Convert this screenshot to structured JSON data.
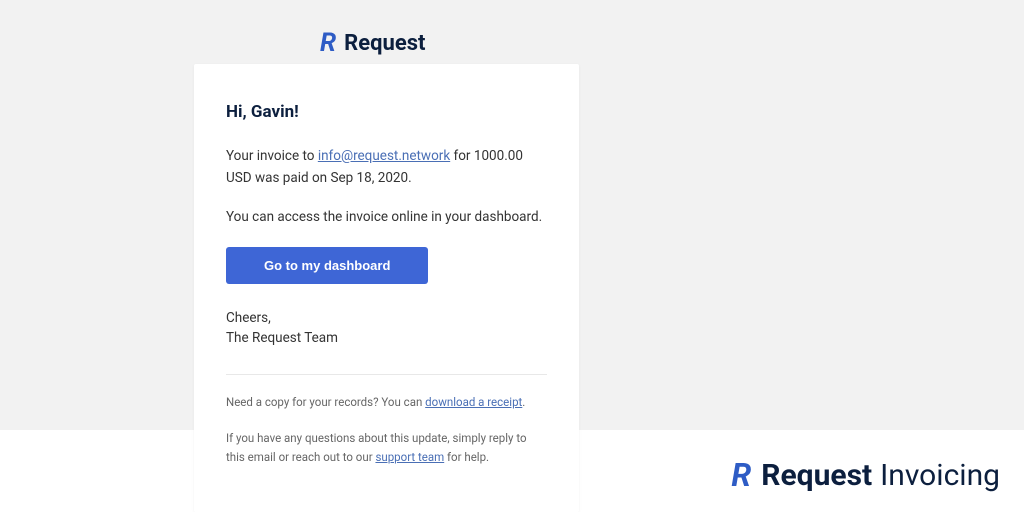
{
  "logo": {
    "brand": "Request"
  },
  "email": {
    "greeting": "Hi, Gavin!",
    "line1_pre": "Your invoice to ",
    "line1_email": "info@request.network",
    "line1_post": " for 1000.00 USD was paid on Sep 18, 2020.",
    "line2": "You can access the invoice online in your dashboard.",
    "cta": "Go to my dashboard",
    "signoff_line1": "Cheers,",
    "signoff_line2": "The Request Team",
    "footer1_pre": "Need a copy for your records? You can ",
    "footer1_link": "download a receipt",
    "footer1_post": ".",
    "footer2_pre": "If you have any questions about this update, simply reply to this email or reach out to our ",
    "footer2_link": "support team",
    "footer2_post": " for help."
  },
  "watermark": {
    "brand": "Request",
    "product": "Invoicing"
  }
}
